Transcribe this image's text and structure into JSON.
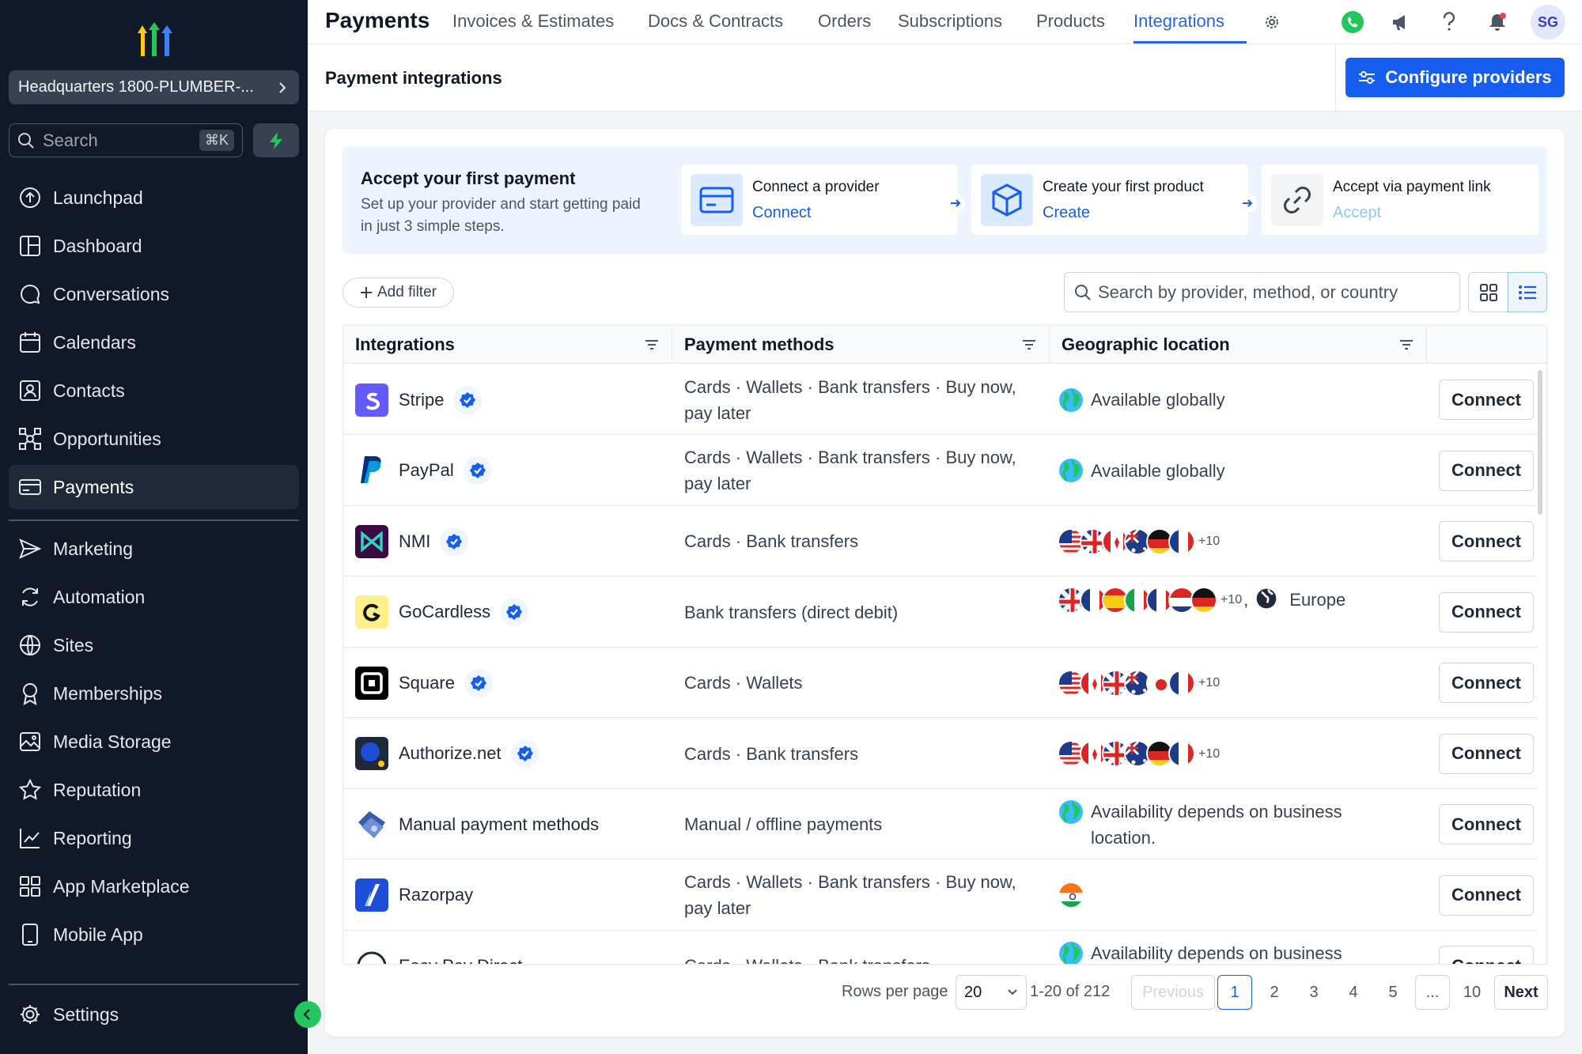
{
  "sidebar": {
    "location": "Headquarters 1800-PLUMBER-...",
    "search_placeholder": "Search",
    "search_shortcut": "⌘K",
    "nav": [
      {
        "label": "Launchpad",
        "icon": "launchpad-icon"
      },
      {
        "label": "Dashboard",
        "icon": "dashboard-icon"
      },
      {
        "label": "Conversations",
        "icon": "conversations-icon"
      },
      {
        "label": "Calendars",
        "icon": "calendar-icon"
      },
      {
        "label": "Contacts",
        "icon": "contacts-icon"
      },
      {
        "label": "Opportunities",
        "icon": "opportunities-icon"
      },
      {
        "label": "Payments",
        "icon": "payments-icon",
        "active": true
      },
      {
        "label": "Marketing",
        "icon": "marketing-icon"
      },
      {
        "label": "Automation",
        "icon": "automation-icon"
      },
      {
        "label": "Sites",
        "icon": "sites-icon"
      },
      {
        "label": "Memberships",
        "icon": "memberships-icon"
      },
      {
        "label": "Media Storage",
        "icon": "media-storage-icon"
      },
      {
        "label": "Reputation",
        "icon": "reputation-icon"
      },
      {
        "label": "Reporting",
        "icon": "reporting-icon"
      },
      {
        "label": "App Marketplace",
        "icon": "app-marketplace-icon"
      },
      {
        "label": "Mobile App",
        "icon": "mobile-app-icon"
      }
    ],
    "settings_label": "Settings"
  },
  "topbar": {
    "title": "Payments",
    "tabs": [
      "Invoices & Estimates",
      "Docs & Contracts",
      "Orders",
      "Subscriptions",
      "Products",
      "Integrations"
    ],
    "active_tab": "Integrations",
    "avatar_initials": "SG"
  },
  "subheader": {
    "title": "Payment integrations",
    "configure_label": "Configure providers"
  },
  "banner": {
    "title": "Accept your first payment",
    "description": "Set up your provider and start getting paid in just 3 simple steps.",
    "steps": [
      {
        "title": "Connect a provider",
        "link": "Connect",
        "enabled": true
      },
      {
        "title": "Create your first product",
        "link": "Create",
        "enabled": true
      },
      {
        "title": "Accept via payment link",
        "link": "Accept",
        "enabled": false
      }
    ]
  },
  "filters": {
    "add_filter_label": "Add filter",
    "search_placeholder": "Search by provider, method, or country"
  },
  "table": {
    "columns": [
      "Integrations",
      "Payment methods",
      "Geographic location"
    ],
    "rows": [
      {
        "name": "Stripe",
        "verified": true,
        "methods": "Cards · Wallets · Bank transfers · Buy now, pay later",
        "location": "Available globally",
        "action": "Connect"
      },
      {
        "name": "PayPal",
        "verified": true,
        "methods": "Cards · Wallets · Bank transfers · Buy now, pay later",
        "location": "Available globally",
        "action": "Connect"
      },
      {
        "name": "NMI",
        "verified": true,
        "methods": "Cards · Bank transfers",
        "location_more": "+10",
        "action": "Connect"
      },
      {
        "name": "GoCardless",
        "verified": true,
        "methods": "Bank transfers (direct debit)",
        "location_more": "+10",
        "location_region": "Europe",
        "action": "Connect"
      },
      {
        "name": "Square",
        "verified": true,
        "methods": "Cards · Wallets",
        "location_more": "+10",
        "action": "Connect"
      },
      {
        "name": "Authorize.net",
        "verified": true,
        "methods": "Cards · Bank transfers",
        "location_more": "+10",
        "action": "Connect"
      },
      {
        "name": "Manual payment methods",
        "verified": false,
        "methods": "Manual / offline payments",
        "location": "Availability depends on business location.",
        "action": "Connect"
      },
      {
        "name": "Razorpay",
        "verified": false,
        "methods": "Cards · Wallets · Bank transfers · Buy now, pay later",
        "location": "",
        "action": "Connect"
      },
      {
        "name": "Easy Pay Direct",
        "verified": false,
        "methods": "Cards · Wallets · Bank transfers",
        "location": "Availability depends on business",
        "action": "Connect"
      }
    ]
  },
  "pagination": {
    "rows_per_page_label": "Rows per page",
    "rows_per_page": "20",
    "range": "1-20 of 212",
    "previous": "Previous",
    "pages": [
      "1",
      "2",
      "3",
      "4",
      "5",
      "...",
      "10"
    ],
    "current_page": "1",
    "next": "Next"
  },
  "colors": {
    "sidebar_bg": "#111827",
    "accent": "#155eef",
    "success": "#22c55e"
  }
}
